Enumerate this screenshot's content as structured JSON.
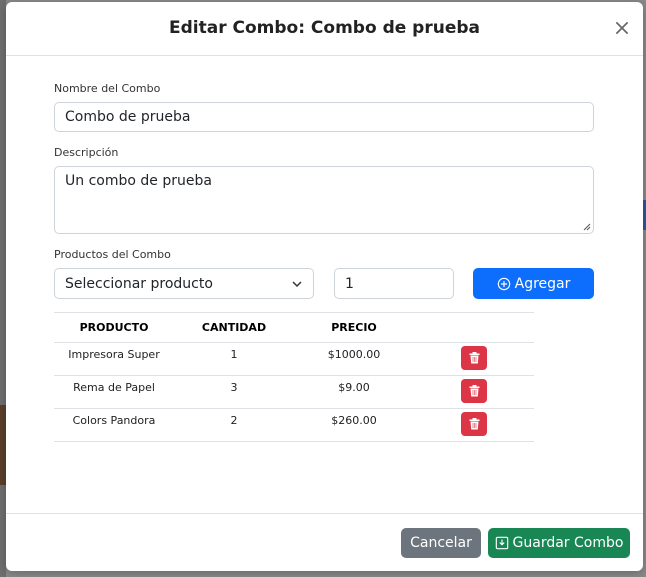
{
  "modal": {
    "title": "Editar Combo: Combo de prueba"
  },
  "form": {
    "name_label": "Nombre del Combo",
    "name_value": "Combo de prueba",
    "description_label": "Descripción",
    "description_value": "Un combo de prueba",
    "products_label": "Productos del Combo",
    "product_select": "Seleccionar producto",
    "quantity_value": "1",
    "add_label": "Agregar"
  },
  "table": {
    "headers": [
      "PRODUCTO",
      "CANTIDAD",
      "PRECIO"
    ],
    "rows": [
      {
        "producto": "Impresora Super",
        "cantidad": "1",
        "precio": "$1000.00"
      },
      {
        "producto": "Rema de Papel",
        "cantidad": "3",
        "precio": "$9.00"
      },
      {
        "producto": "Colors Pandora",
        "cantidad": "2",
        "precio": "$260.00"
      }
    ]
  },
  "footer": {
    "cancel_label": "Cancelar",
    "save_label": "Guardar Combo"
  },
  "colors": {
    "primary": "#0d6efd",
    "danger": "#dc3545",
    "secondary": "#6c757d",
    "success": "#198754"
  },
  "icons": {
    "close": "close-icon",
    "select": "chevron-down-icon",
    "add": "plus-circle-icon",
    "delete": "trash-icon",
    "save": "save-icon"
  }
}
